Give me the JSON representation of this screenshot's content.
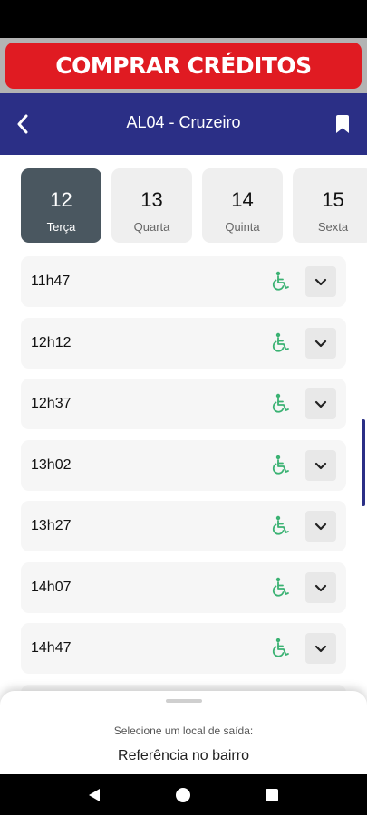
{
  "banner": {
    "label": "COMPRAR CRÉDITOS"
  },
  "header": {
    "title": "AL04 - Cruzeiro",
    "back_icon": "chevron-left-icon",
    "bookmark_icon": "bookmark-icon"
  },
  "days": [
    {
      "number": "12",
      "name": "Terça",
      "selected": true
    },
    {
      "number": "13",
      "name": "Quarta",
      "selected": false
    },
    {
      "number": "14",
      "name": "Quinta",
      "selected": false
    },
    {
      "number": "15",
      "name": "Sexta",
      "selected": false
    }
  ],
  "times": [
    {
      "time": "11h47",
      "accessible": true
    },
    {
      "time": "12h12",
      "accessible": true
    },
    {
      "time": "12h37",
      "accessible": true
    },
    {
      "time": "13h02",
      "accessible": true
    },
    {
      "time": "13h27",
      "accessible": true
    },
    {
      "time": "14h07",
      "accessible": true
    },
    {
      "time": "14h47",
      "accessible": true
    }
  ],
  "sheet": {
    "prompt": "Selecione um local de saída:",
    "value": "Referência no bairro"
  },
  "colors": {
    "brand": "#2b2f86",
    "banner": "#e01b22",
    "accessible_icon": "#3bb273",
    "selected_day": "#4a5760"
  }
}
